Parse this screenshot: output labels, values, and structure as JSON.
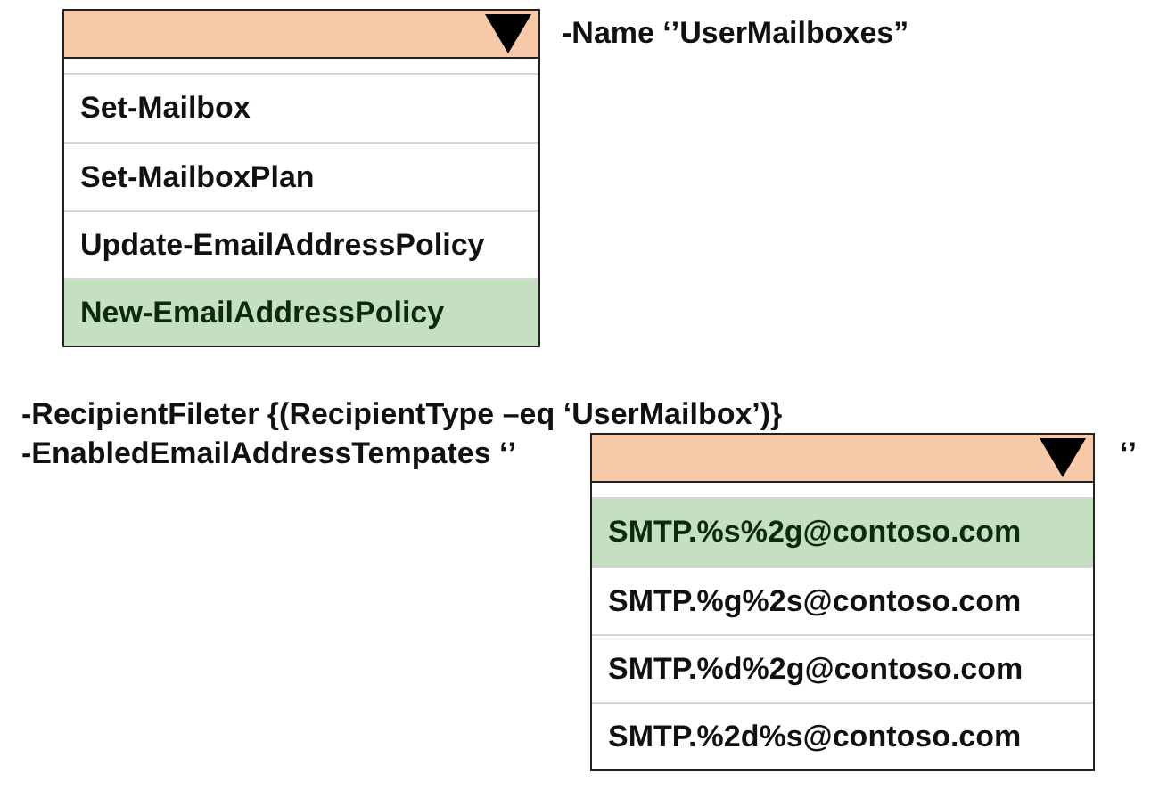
{
  "command_dropdown": {
    "options": [
      {
        "label": "Set-Mailbox",
        "selected": false
      },
      {
        "label": "Set-MailboxPlan",
        "selected": false
      },
      {
        "label": "Update-EmailAddressPolicy",
        "selected": false
      },
      {
        "label": "New-EmailAddressPolicy",
        "selected": true
      }
    ]
  },
  "name_parameter": "-Name ‘’UserMailboxes”",
  "filter_line": "-RecipientFileter {(RecipientType –eq ‘UserMailbox’)}",
  "templates_label": "-EnabledEmailAddressTempates ‘’",
  "template_dropdown": {
    "options": [
      {
        "label": "SMTP.%s%2g@contoso.com",
        "selected": true
      },
      {
        "label": "SMTP.%g%2s@contoso.com",
        "selected": false
      },
      {
        "label": "SMTP.%d%2g@contoso.com",
        "selected": false
      },
      {
        "label": "SMTP.%2d%s@contoso.com",
        "selected": false
      }
    ]
  },
  "closing_quote": "‘’"
}
